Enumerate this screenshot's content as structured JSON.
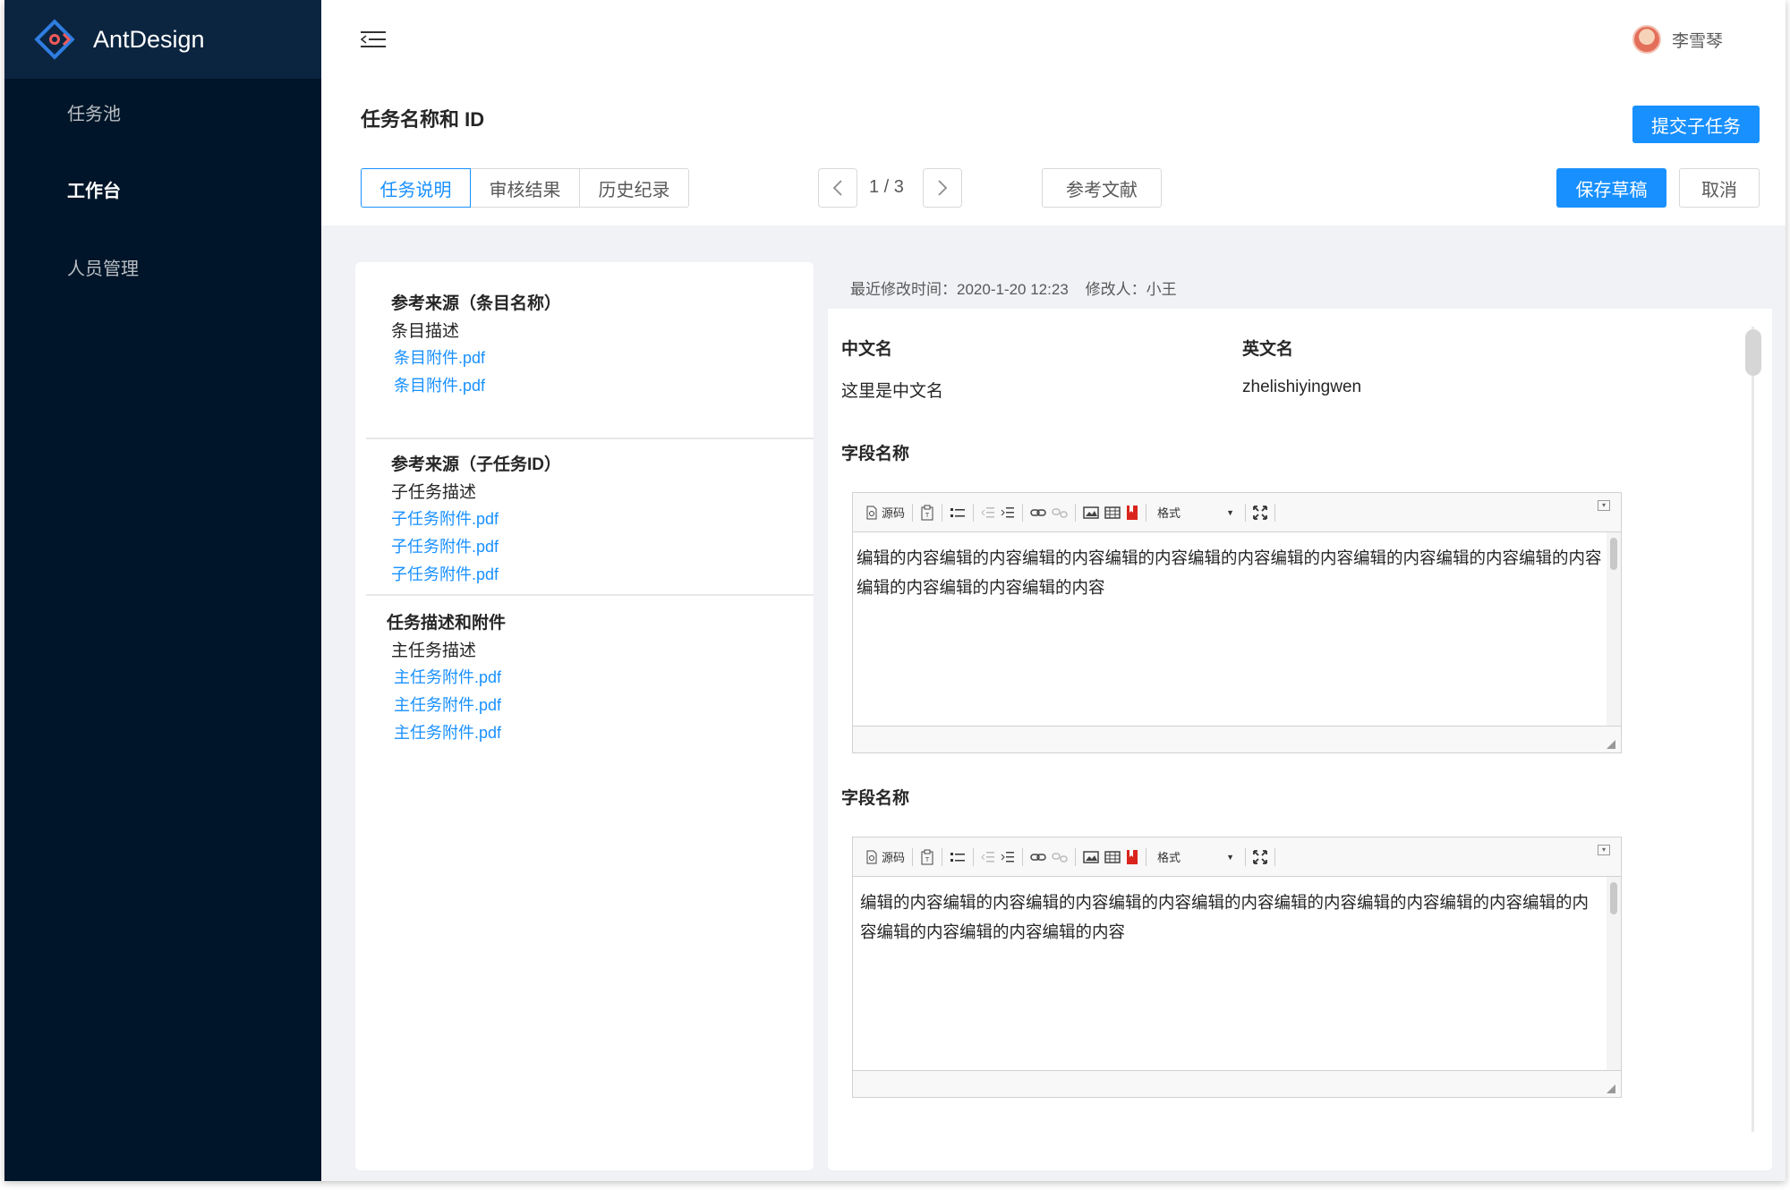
{
  "app": {
    "brand": "AntDesign"
  },
  "sidebar": {
    "items": [
      {
        "label": "任务池",
        "active": false
      },
      {
        "label": "工作台",
        "active": true
      },
      {
        "label": "人员管理",
        "active": false
      }
    ]
  },
  "header": {
    "user_name": "李雪琴",
    "page_title": "任务名称和 ID",
    "submit_label": "提交子任务",
    "tabs": [
      {
        "label": "任务说明",
        "active": true
      },
      {
        "label": "审核结果",
        "active": false
      },
      {
        "label": "历史纪录",
        "active": false
      }
    ],
    "pager": {
      "text": "1 / 3"
    },
    "reference_label": "参考文献",
    "save_draft_label": "保存草稿",
    "cancel_label": "取消"
  },
  "left_panel": {
    "blocks": [
      {
        "title": "参考来源（条目名称）",
        "desc": "条目描述",
        "links": [
          "条目附件.pdf",
          "条目附件.pdf"
        ]
      },
      {
        "title": "参考来源（子任务ID）",
        "desc": "子任务描述",
        "links": [
          "子任务附件.pdf",
          "子任务附件.pdf",
          "子任务附件.pdf"
        ]
      },
      {
        "title": "任务描述和附件",
        "desc": "主任务描述",
        "links": [
          "主任务附件.pdf",
          "主任务附件.pdf",
          "主任务附件.pdf"
        ]
      }
    ]
  },
  "right_panel": {
    "meta": "最近修改时间：2020-1-20 12:23    修改人：小王",
    "cn_name_label": "中文名",
    "cn_name_value": "这里是中文名",
    "en_name_label": "英文名",
    "en_name_value": "zhelishiyingwen",
    "editors": [
      {
        "label": "字段名称",
        "toolbar": {
          "source": "源码",
          "format": "格式"
        },
        "content": "编辑的内容编辑的内容编辑的内容编辑的内容编辑的内容编辑的内容编辑的内容编辑的内容编辑的内容编辑的内容编辑的内容编辑的内容"
      },
      {
        "label": "字段名称",
        "toolbar": {
          "source": "源码",
          "format": "格式"
        },
        "content": "编辑的内容编辑的内容编辑的内容编辑的内容编辑的内容编辑的内容编辑的内容编辑的内容编辑的内容编辑的内容编辑的内容编辑的内容"
      }
    ]
  },
  "colors": {
    "primary": "#1890ff",
    "sider": "#001529",
    "logo_bar": "#0b2540",
    "page_bg": "#f0f2f5"
  },
  "icons": [
    "logo-icon",
    "menu-fold-icon",
    "avatar",
    "chevron-left-icon",
    "chevron-right-icon"
  ]
}
